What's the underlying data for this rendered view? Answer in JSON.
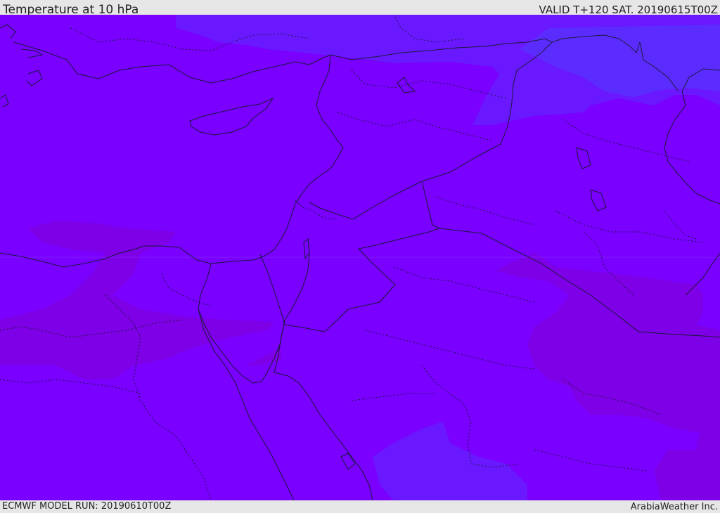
{
  "header": {
    "title": "Temperature at 10 hPa",
    "valid_time": "VALID T+120 SAT. 20190615T00Z"
  },
  "footer": {
    "model_run": "ECMWF MODEL RUN: 20190610T00Z",
    "credit": "ArabiaWeather Inc."
  },
  "map": {
    "field_colors": {
      "main": "#7a00ff",
      "warmer": "#7e00e6",
      "cooler": "#6a18ff",
      "coolest": "#5c2cff"
    },
    "line_colors": {
      "coast": "#1a1a3a",
      "border": "#1a1a3a"
    }
  }
}
